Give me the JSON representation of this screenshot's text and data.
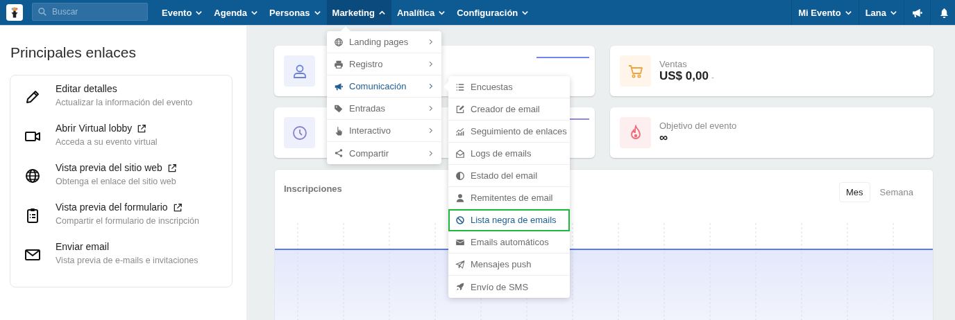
{
  "nav": {
    "search": {
      "placeholder": "Buscar"
    },
    "menus": [
      {
        "label": "Evento",
        "expanded": false
      },
      {
        "label": "Agenda",
        "expanded": false
      },
      {
        "label": "Personas",
        "expanded": false
      },
      {
        "label": "Marketing",
        "expanded": true
      },
      {
        "label": "Analítica",
        "expanded": false
      },
      {
        "label": "Configuración",
        "expanded": false
      }
    ],
    "user_menus": [
      {
        "label": "Mi Evento",
        "expanded": false
      },
      {
        "label": "Lana",
        "expanded": false
      }
    ]
  },
  "sidebar": {
    "title": "Principales enlaces",
    "links": [
      {
        "kind": "pencil",
        "title": "Editar detalles",
        "subtitle": "Actualizar la información del evento",
        "external": false
      },
      {
        "kind": "video",
        "title": "Abrir Virtual lobby",
        "subtitle": "Acceda a su evento virtual",
        "external": true
      },
      {
        "kind": "globe",
        "title": "Vista previa del sitio web",
        "subtitle": "Obtenga el enlace del sitio web",
        "external": true
      },
      {
        "kind": "clipboard",
        "title": "Vista previa del formulario",
        "subtitle": "Compartir el formulario de inscripción",
        "external": true
      },
      {
        "kind": "envelope",
        "title": "Enviar email",
        "subtitle": "Vista previa de e-mails e invitaciones",
        "external": false
      }
    ]
  },
  "stats": [
    {
      "kind": "user"
    },
    {
      "kind": "cart",
      "label": "Ventas",
      "value": "US$ 0,00",
      "note": "-"
    },
    {
      "kind": "clock"
    },
    {
      "kind": "flame",
      "label": "Objetivo del evento",
      "value": "∞"
    }
  ],
  "chart": {
    "title": "Inscripciones",
    "periods": [
      {
        "label": "Mes",
        "selected": true
      },
      {
        "label": "Semana",
        "selected": false
      }
    ]
  },
  "marketing_menu": {
    "items": [
      {
        "kind": "globe",
        "label": "Landing pages",
        "selected": false
      },
      {
        "kind": "printer",
        "label": "Registro",
        "selected": false
      },
      {
        "kind": "megaphone",
        "label": "Comunicación",
        "selected": true
      },
      {
        "kind": "tags",
        "label": "Entradas",
        "selected": false
      },
      {
        "kind": "hand",
        "label": "Interactivo",
        "selected": false
      },
      {
        "kind": "share",
        "label": "Compartir",
        "selected": false
      }
    ]
  },
  "submenu": {
    "items": [
      {
        "kind": "list",
        "label": "Encuestas",
        "selected": false,
        "highlighted": false
      },
      {
        "kind": "edit",
        "label": "Creador de email",
        "selected": false,
        "highlighted": false
      },
      {
        "kind": "bars",
        "label": "Seguimiento de enlaces",
        "selected": false,
        "highlighted": false
      },
      {
        "kind": "open-envelope",
        "label": "Logs de emails",
        "selected": false,
        "highlighted": false
      },
      {
        "kind": "half-circle",
        "label": "Estado del email",
        "selected": false,
        "highlighted": false
      },
      {
        "kind": "person",
        "label": "Remitentes de email",
        "selected": false,
        "highlighted": false
      },
      {
        "kind": "ban",
        "label": "Lista negra de emails",
        "selected": true,
        "highlighted": true
      },
      {
        "kind": "envelope-solid",
        "label": "Emails automáticos",
        "selected": false,
        "highlighted": false
      },
      {
        "kind": "paper-plane",
        "label": "Mensajes push",
        "selected": false,
        "highlighted": false
      },
      {
        "kind": "rocket",
        "label": "Envío de SMS",
        "selected": false,
        "highlighted": false
      }
    ]
  }
}
